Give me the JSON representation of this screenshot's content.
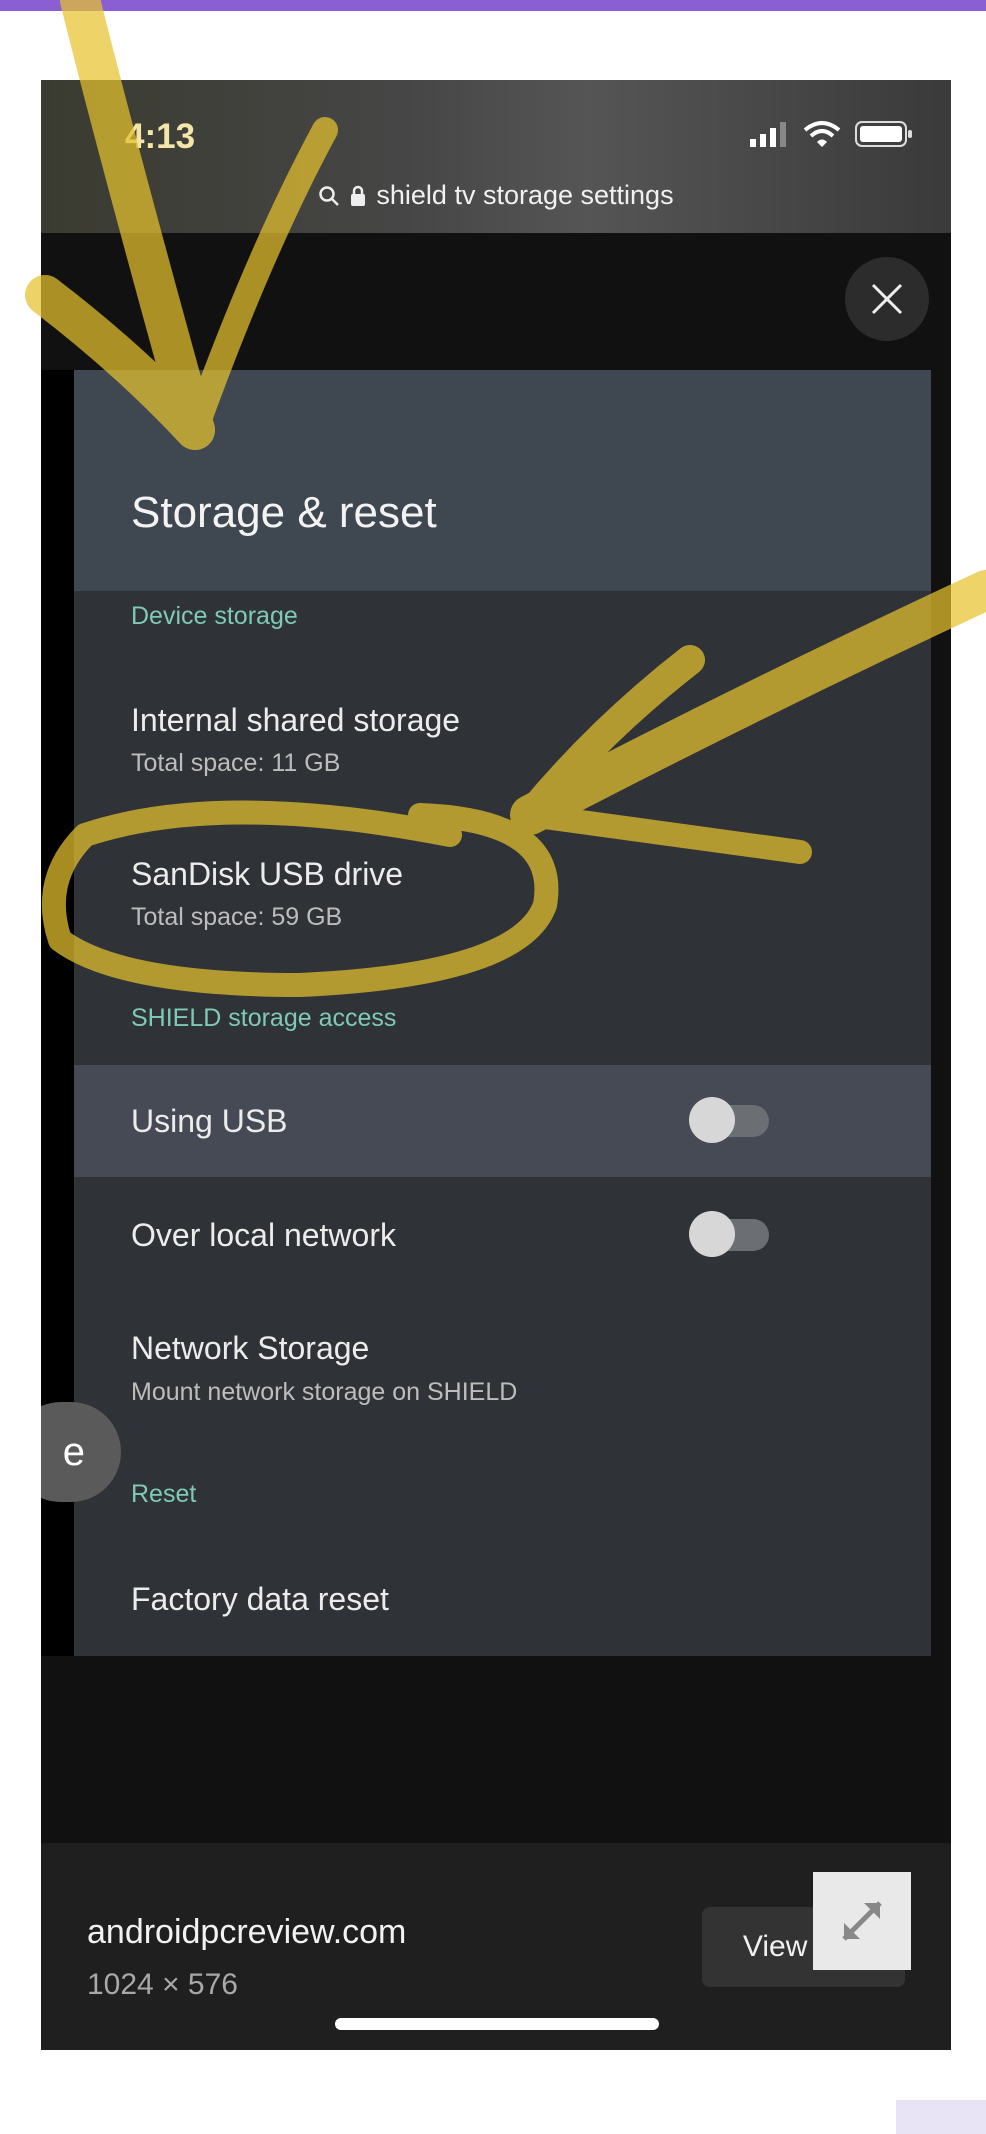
{
  "status_bar": {
    "time": "4:13",
    "url": "shield tv storage settings"
  },
  "tv_screen": {
    "title": "Storage & reset",
    "section_device_storage": "Device storage",
    "internal_title": "Internal shared storage",
    "internal_sub": "Total space: 11 GB",
    "sandisk_title": "SanDisk USB drive",
    "sandisk_sub": "Total space: 59 GB",
    "section_access": "SHIELD storage access",
    "using_usb": "Using USB",
    "using_usb_on": false,
    "over_network": "Over local network",
    "over_network_on": false,
    "network_storage_title": "Network Storage",
    "network_storage_sub": "Mount network storage on SHIELD",
    "section_reset": "Reset",
    "factory_reset": "Factory data reset"
  },
  "footer": {
    "source": "androidpcreview.com",
    "dimensions": "1024 × 576",
    "view_file": "View File"
  },
  "left_pill_text": "e",
  "colors": {
    "accent_top": "#8a5fd4",
    "highlighter": "#e6c22e",
    "section_teal": "#7fcab7"
  },
  "icons": [
    "signal-icon",
    "wifi-icon",
    "battery-icon",
    "search-icon",
    "lock-icon",
    "close-icon",
    "expand-icon"
  ]
}
